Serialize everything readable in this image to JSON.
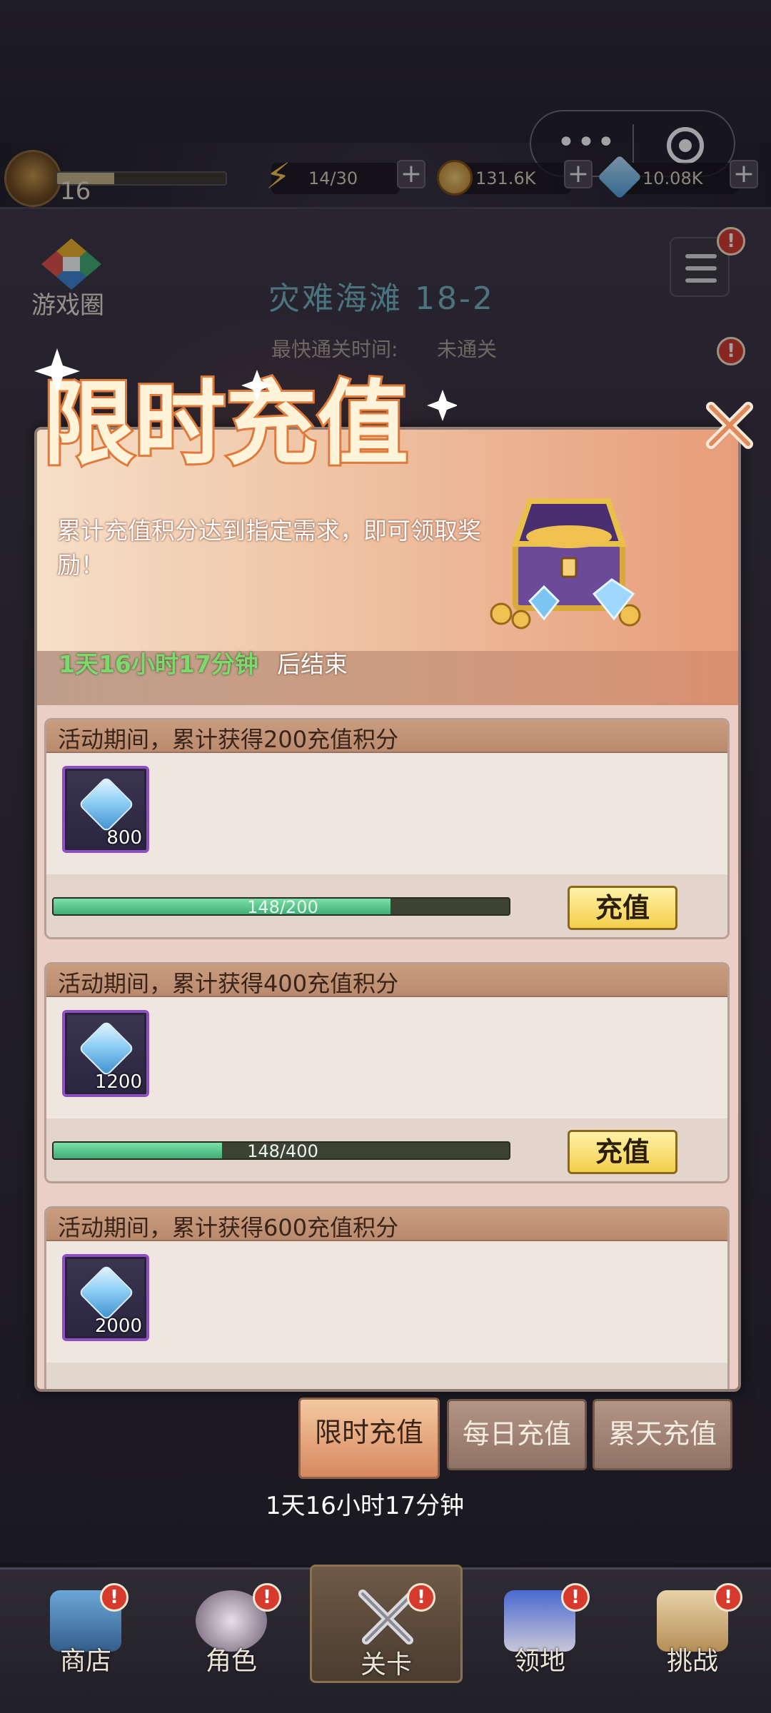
{
  "capsule": {
    "more": "•••"
  },
  "resources": {
    "level": "16",
    "energy": "14/30",
    "coins": "131.6K",
    "gems": "10.08K",
    "plus": "+"
  },
  "stage": {
    "game_circle": "游戏圈",
    "title": "灾难海滩 18-2",
    "clear_label": "最快通关时间:",
    "clear_value": "未通关"
  },
  "alert": "!",
  "modal": {
    "title": "限时充值",
    "description": "累计充值积分达到指定需求，即可领取奖励！",
    "countdown": "1天16小时17分钟",
    "countdown_suffix": "后结束",
    "tasks": [
      {
        "title": "活动期间，累计获得200充值积分",
        "reward_count": "800",
        "progress_text": "148/200",
        "progress": 0.74,
        "button": "充值"
      },
      {
        "title": "活动期间，累计获得400充值积分",
        "reward_count": "1200",
        "progress_text": "148/400",
        "progress": 0.37,
        "button": "充值"
      },
      {
        "title": "活动期间，累计获得600充值积分",
        "reward_count": "2000"
      }
    ]
  },
  "tabs": {
    "limited": "限时充值",
    "daily": "每日充值",
    "cumulative": "累天充值",
    "countdown": "1天16小时17分钟"
  },
  "nav": [
    {
      "label": "商店"
    },
    {
      "label": "角色"
    },
    {
      "label": "关卡"
    },
    {
      "label": "领地"
    },
    {
      "label": "挑战"
    }
  ],
  "colors": {
    "accent_gold": "#f3cf4c",
    "progress_green": "#3fae74",
    "countdown_green": "#7dd96c",
    "alert_red": "#d63a2c"
  }
}
